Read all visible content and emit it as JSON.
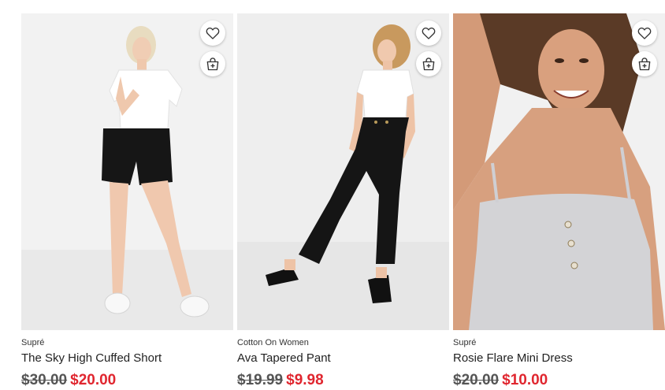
{
  "colors": {
    "sale_price": "#e0262f",
    "was_price": "#555555",
    "image_background": "#efefef"
  },
  "products": [
    {
      "brand": "Supré",
      "name": "The Sky High Cuffed Short",
      "was_price": "$30.00",
      "price": "$20.00",
      "image_alt": "Model wearing white tee and black high-waisted shorts with white sneakers"
    },
    {
      "brand": "Cotton On Women",
      "name": "Ava Tapered Pant",
      "was_price": "$19.99",
      "price": "$9.98",
      "image_alt": "Model wearing white top and black tapered pants with black sandals"
    },
    {
      "brand": "Supré",
      "name": "Rosie Flare Mini Dress",
      "was_price": "$20.00",
      "price": "$10.00",
      "image_alt": "Smiling model wearing grey ribbed button-front mini dress"
    }
  ],
  "icons": {
    "wishlist": "heart-icon",
    "add_to_bag": "shopping-bag-plus-icon"
  }
}
